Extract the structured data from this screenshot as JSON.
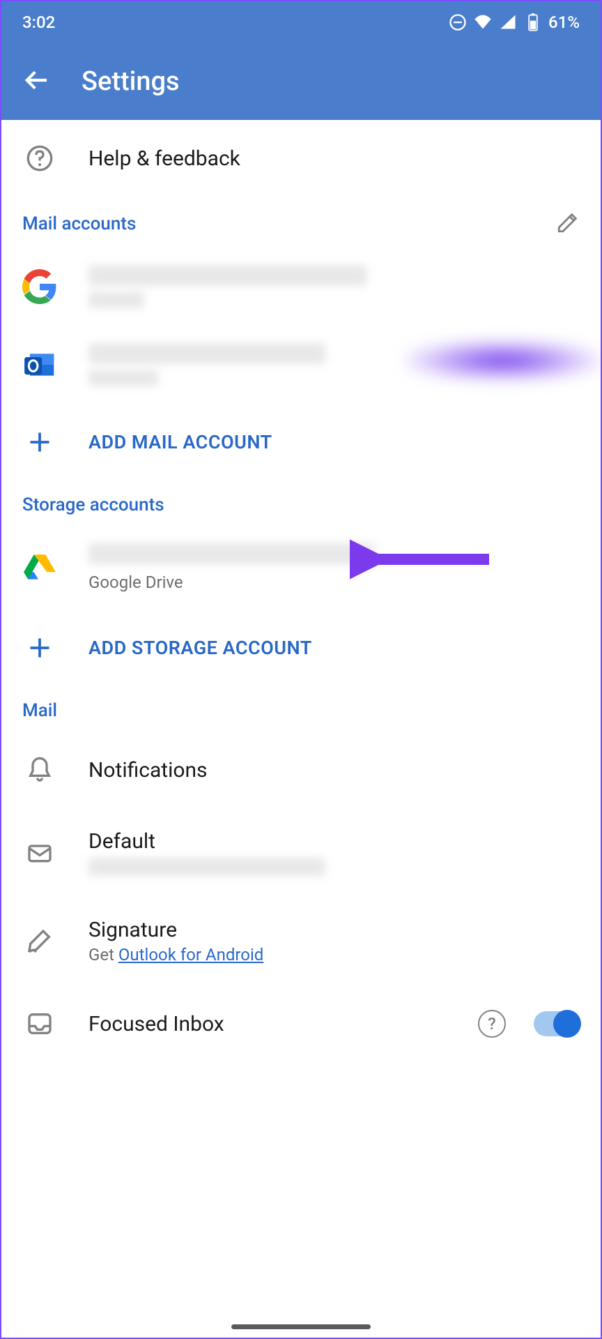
{
  "status": {
    "time": "3:02",
    "battery": "61%"
  },
  "header": {
    "title": "Settings"
  },
  "help": {
    "label": "Help & feedback"
  },
  "sections": {
    "mail_accounts": "Mail accounts",
    "storage_accounts": "Storage accounts",
    "mail": "Mail"
  },
  "add_mail": "ADD MAIL ACCOUNT",
  "add_storage": "ADD STORAGE ACCOUNT",
  "storage_item": {
    "sublabel": "Google Drive"
  },
  "mail_settings": {
    "notifications": "Notifications",
    "default": "Default",
    "signature": {
      "label": "Signature",
      "prefix": "Get ",
      "link": "Outlook for Android"
    },
    "focused": "Focused Inbox"
  }
}
